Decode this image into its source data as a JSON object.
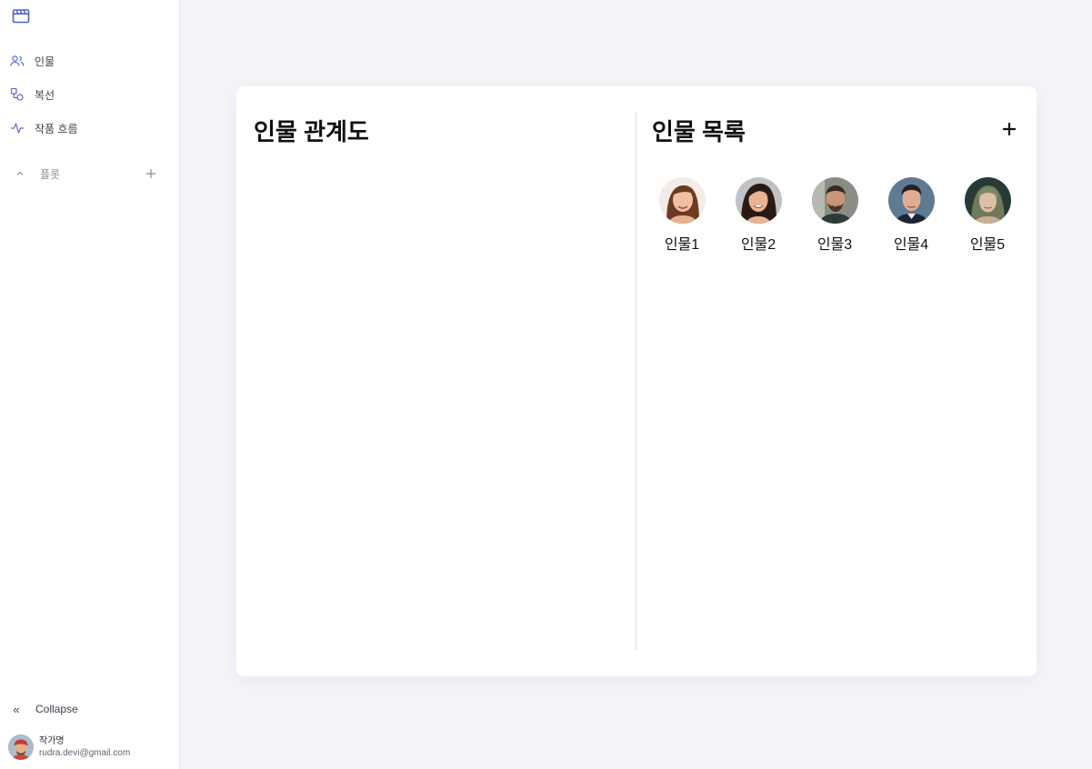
{
  "sidebar": {
    "logo_icon": "clapperboard-icon",
    "nav": [
      {
        "label": "인물",
        "icon": "people-icon"
      },
      {
        "label": "복선",
        "icon": "shapes-icon"
      },
      {
        "label": "작품 흐름",
        "icon": "pulse-icon"
      }
    ],
    "plot": {
      "label": "플롯",
      "toggle_icon": "chevron-up-icon",
      "add_icon": "plus-icon"
    },
    "collapse": {
      "label": "Collapse",
      "icon": "double-chevron-left-icon"
    },
    "user": {
      "name": "작가명",
      "email": "rudra.devi@gmail.com"
    }
  },
  "main": {
    "relationship_title": "인물 관계도",
    "list_title": "인물 목록",
    "add_icon": "plus-icon",
    "characters": [
      {
        "name": "인물1"
      },
      {
        "name": "인물2"
      },
      {
        "name": "인물3"
      },
      {
        "name": "인물4"
      },
      {
        "name": "인물5"
      }
    ]
  },
  "colors": {
    "background": "#f4f5f9",
    "card": "#ffffff",
    "logo": "#4a63c8",
    "nav_icon": "#5b6bd0"
  }
}
